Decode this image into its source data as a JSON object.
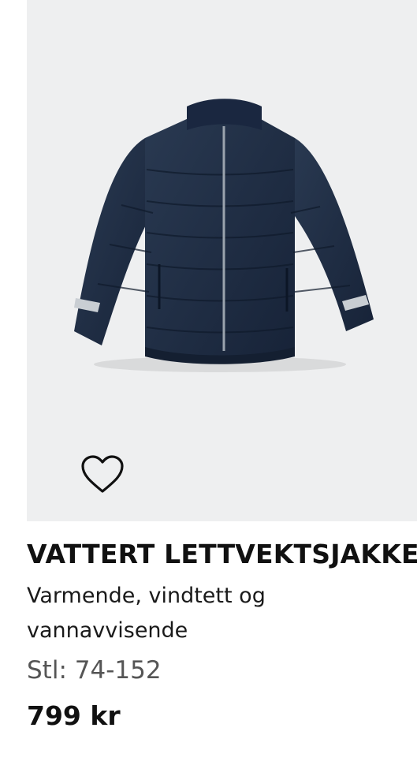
{
  "product": {
    "title": "VATTERT LETTVEKTSJAKKE",
    "description": "Varmende, vindtett og vannavvisende",
    "size": "Stl: 74-152",
    "price": "799 kr"
  },
  "image": {
    "subject": "navy-puffer-jacket",
    "background_color": "#eeeff0",
    "jacket_color": "#1f2e44"
  },
  "favorite": {
    "icon": "heart-outline-icon",
    "state": "not-favorited"
  }
}
